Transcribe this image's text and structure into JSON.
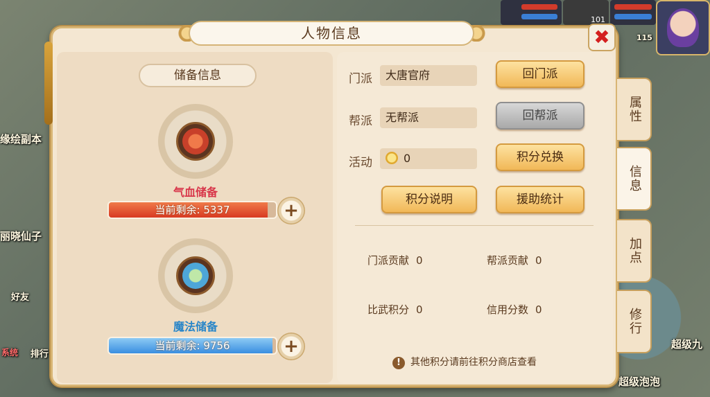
{
  "game_bg": {
    "labels": {
      "dungeon": "缘绘副本",
      "npc_left": "丽晓仙子",
      "friends": "好友",
      "system_tag": "系统",
      "rank": "排行",
      "right_name1": "超级九",
      "right_name2": "超级泡泡",
      "hud_level1": "101",
      "hud_level2": "115"
    }
  },
  "panel": {
    "title": "人物信息",
    "close_symbol": "✖"
  },
  "storage": {
    "section_title": "储备信息",
    "hp": {
      "name": "气血储备",
      "remaining_label": "当前剩余:",
      "remaining_value": "5337",
      "fill_percent": 95,
      "color": "#e2502c"
    },
    "mp": {
      "name": "魔法储备",
      "remaining_label": "当前剩余:",
      "remaining_value": "9756",
      "fill_percent": 98,
      "color": "#4aa3e8"
    },
    "plus_symbol": "+"
  },
  "info": {
    "sect_label": "门派",
    "sect_value": "大唐官府",
    "guild_label": "帮派",
    "guild_value": "无帮派",
    "activity_label": "活动",
    "activity_value": "0",
    "btn_return_sect": "回门派",
    "btn_return_guild": "回帮派",
    "btn_points_exchange": "积分兑换",
    "btn_points_explain": "积分说明",
    "btn_assist_stats": "援助统计",
    "stats": {
      "sect_contrib_label": "门派贡献",
      "sect_contrib_value": "0",
      "guild_contrib_label": "帮派贡献",
      "guild_contrib_value": "0",
      "arena_points_label": "比武积分",
      "arena_points_value": "0",
      "credit_label": "信用分数",
      "credit_value": "0"
    },
    "note": "其他积分请前往积分商店查看"
  },
  "side_tabs": [
    {
      "label": "属性",
      "active": false
    },
    {
      "label": "信息",
      "active": true
    },
    {
      "label": "加点",
      "active": false
    },
    {
      "label": "修行",
      "active": false
    }
  ]
}
